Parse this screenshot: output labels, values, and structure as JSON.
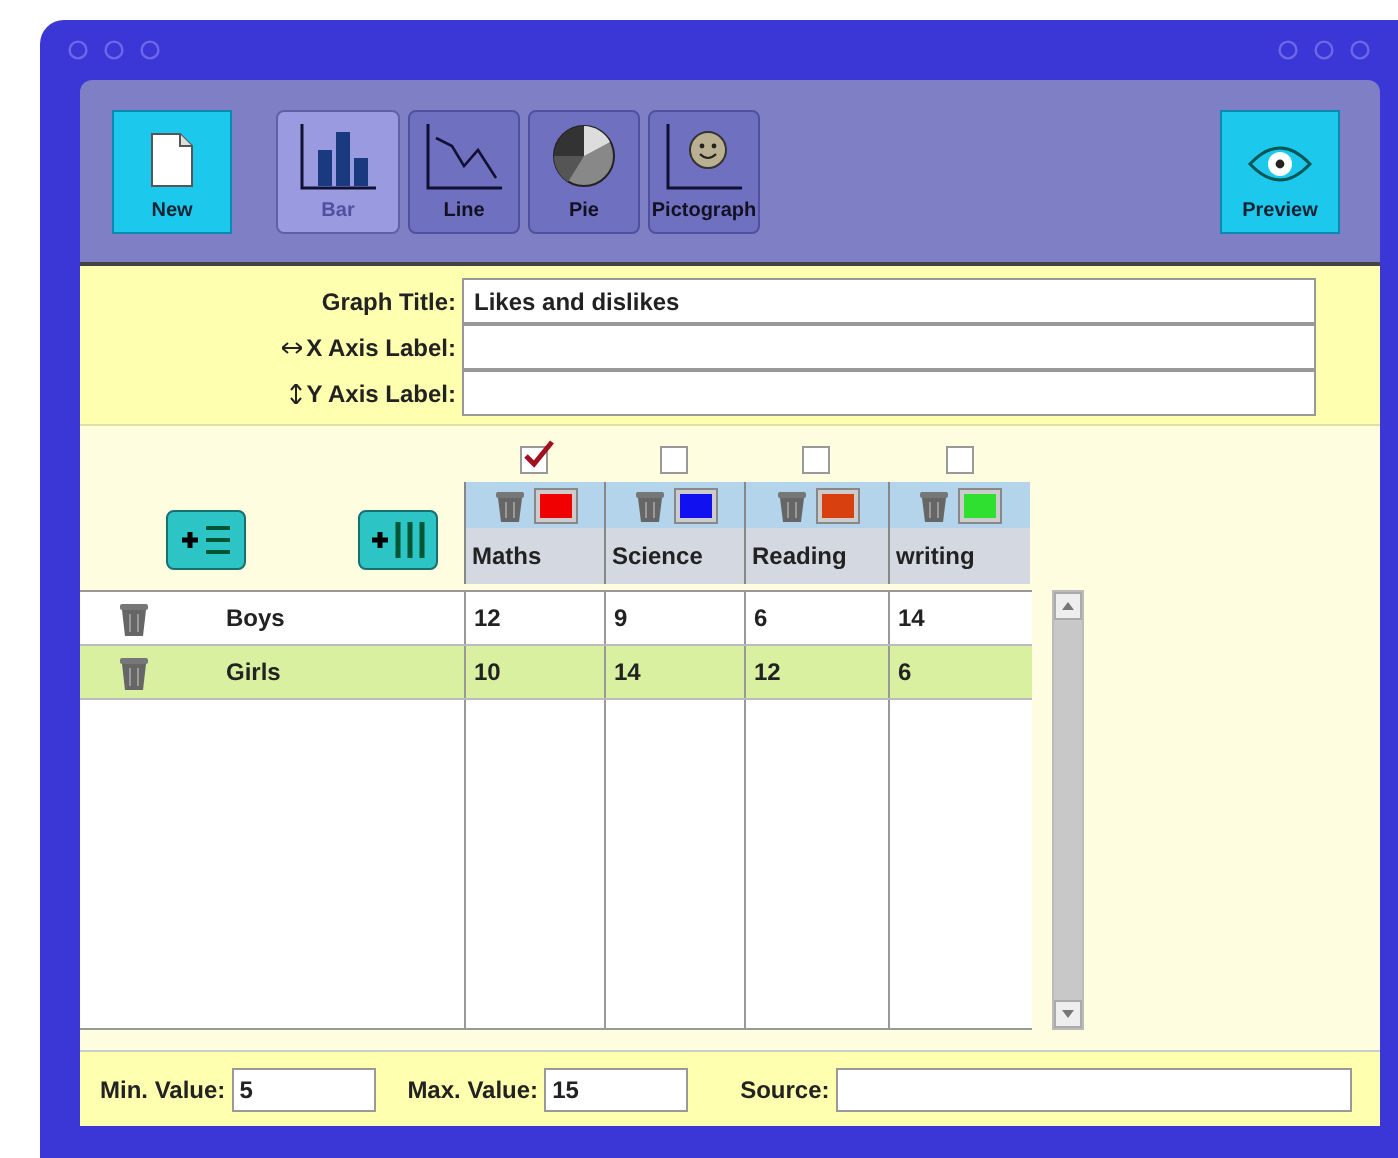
{
  "toolbar": {
    "new_button": "New",
    "chart_types": [
      {
        "label": "Bar",
        "kind": "bar",
        "selected": true
      },
      {
        "label": "Line",
        "kind": "line",
        "selected": false
      },
      {
        "label": "Pie",
        "kind": "pie",
        "selected": false
      },
      {
        "label": "Pictograph",
        "kind": "pictograph",
        "selected": false
      }
    ],
    "preview_button": "Preview"
  },
  "labels": [
    {
      "label": "Graph Title:",
      "value": "Likes and dislikes",
      "kind": "title"
    },
    {
      "label": "X Axis Label:",
      "kind": "x"
    },
    {
      "label": "Y Axis Label:",
      "kind": "y"
    }
  ],
  "columns": [
    {
      "name": "Maths",
      "checked": true,
      "color": "#f00000"
    },
    {
      "name": "Science",
      "checked": false,
      "color": "#1010f0"
    },
    {
      "name": "Reading",
      "checked": false,
      "color": "#d84010"
    },
    {
      "name": "writing",
      "checked": false,
      "color": "#30e030"
    }
  ],
  "rows": [
    {
      "name": "Boys",
      "values": [
        "12",
        "9",
        "6",
        "14"
      ],
      "selected": false
    },
    {
      "name": "Girls",
      "values": [
        "10",
        "14",
        "12",
        "6"
      ],
      "selected": true
    }
  ],
  "footer": {
    "min_label": "Min. Value:",
    "min_value": "5",
    "max_label": "Max. Value:",
    "max_value": "15",
    "source_label": "Source:"
  }
}
